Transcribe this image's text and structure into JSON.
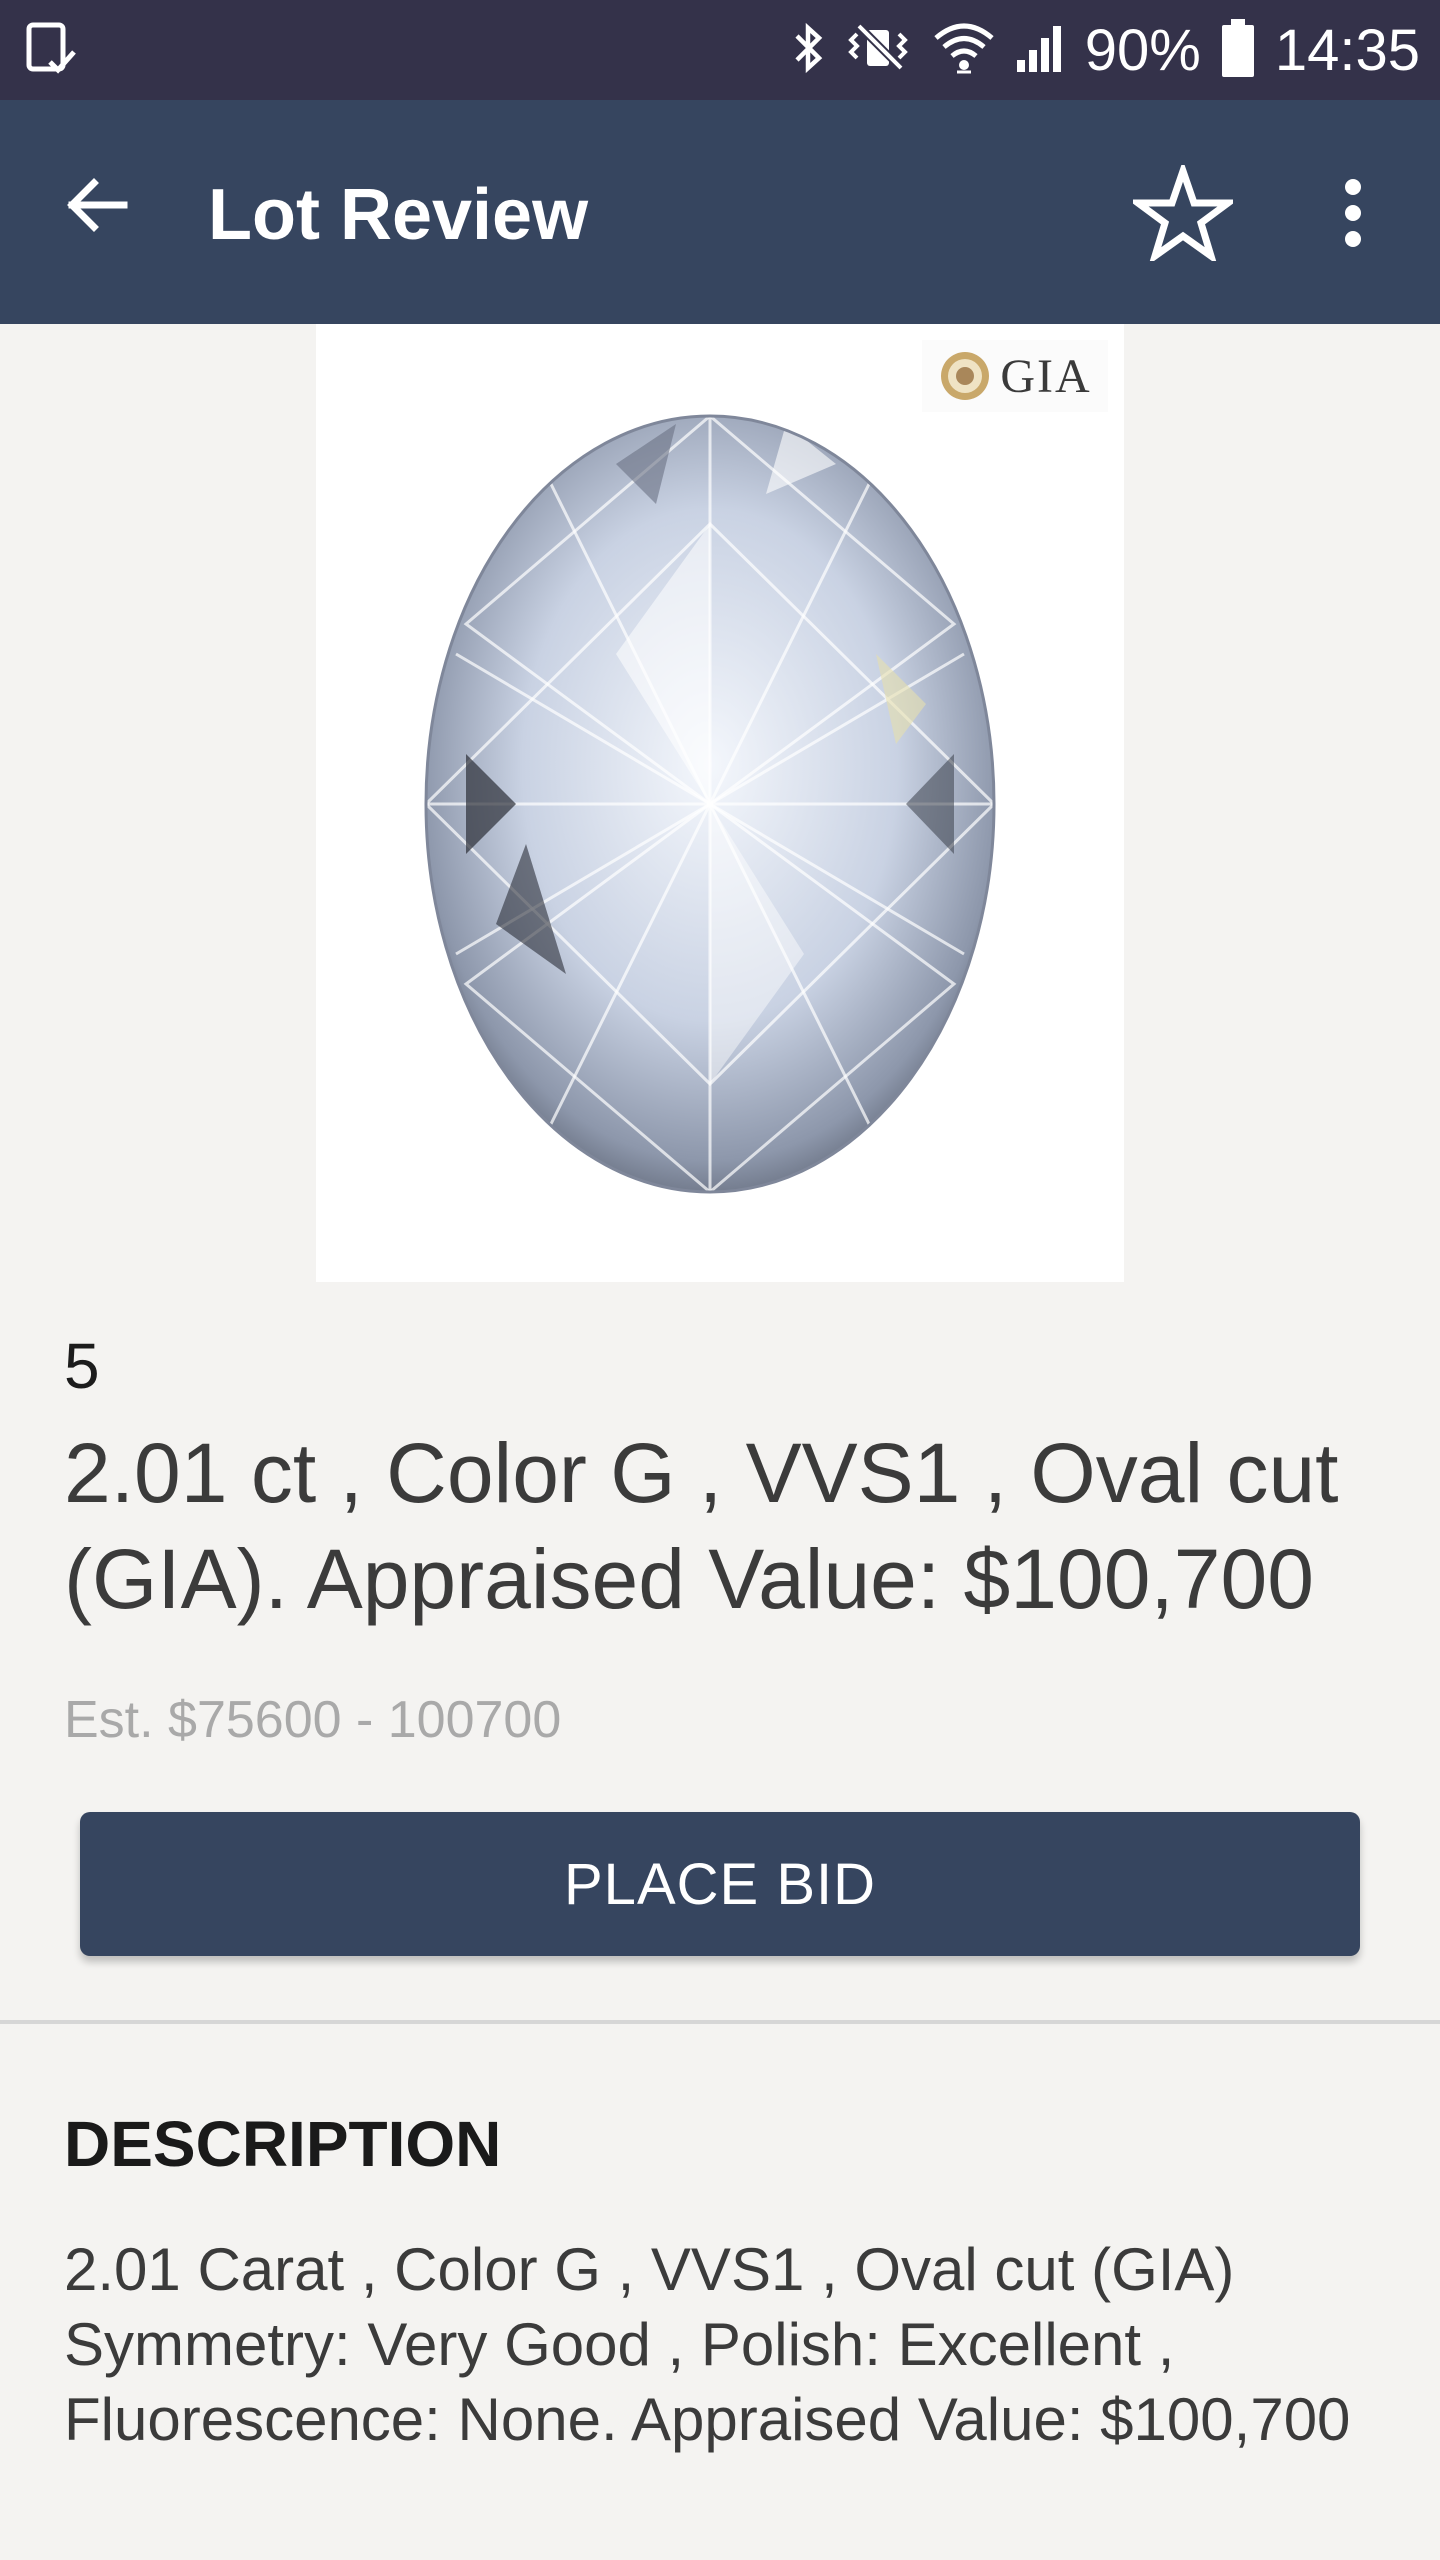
{
  "status_bar": {
    "battery": "90%",
    "time": "14:35",
    "icons": [
      "screenshot-notification-icon",
      "bluetooth-icon",
      "vibrate-icon",
      "wifi-icon",
      "signal-icon",
      "battery-icon"
    ]
  },
  "app_bar": {
    "title": "Lot Review",
    "icons": [
      "back-arrow-icon",
      "star-outline-icon",
      "more-vert-icon"
    ]
  },
  "lot": {
    "image_logo_text": "GIA",
    "number": "5",
    "title": "2.01 ct , Color G , VVS1 , Oval cut (GIA). Appraised Value: $100,700",
    "estimate": "Est. $75600 - 100700",
    "place_bid_label": "PLACE BID"
  },
  "description": {
    "heading": "DESCRIPTION",
    "body": "2.01 Carat , Color G , VVS1 , Oval cut (GIA) Symmetry: Very Good , Polish: Excellent , Fluorescence: None. Appraised Value: $100,700"
  },
  "colors": {
    "status_bar_bg": "#34324a",
    "app_bar_bg": "#36455f",
    "page_bg": "#f4f3f1",
    "button_bg": "#36455f"
  }
}
